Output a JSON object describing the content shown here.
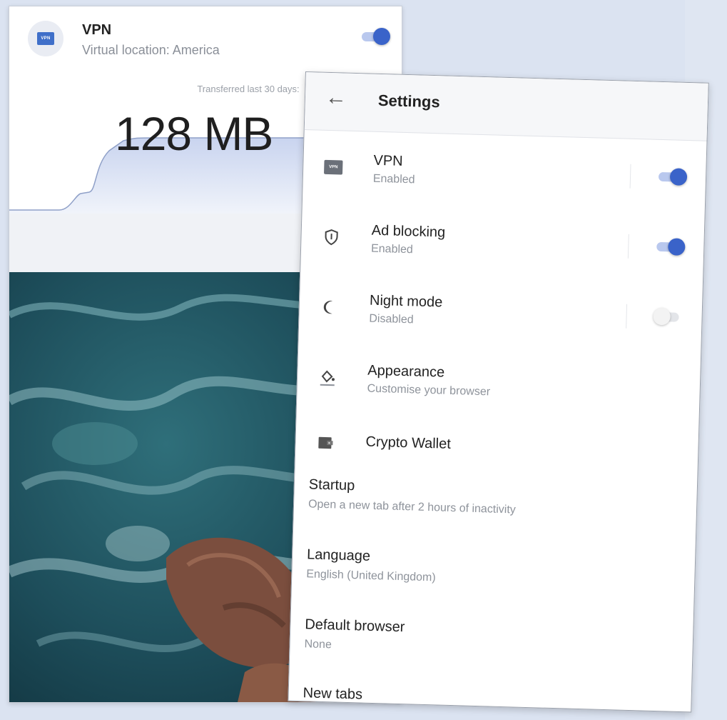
{
  "vpn_popup": {
    "badge_text": "VPN",
    "title": "VPN",
    "subtitle": "Virtual location: America",
    "transfer_label": "Transferred last 30 days:",
    "transfer_value": "128 MB",
    "toggle_on": true
  },
  "settings": {
    "title": "Settings",
    "toggle_rows": [
      {
        "label": "VPN",
        "status": "Enabled",
        "icon": "vpn-icon",
        "on": true
      },
      {
        "label": "Ad blocking",
        "status": "Enabled",
        "icon": "shield-icon",
        "on": true
      },
      {
        "label": "Night mode",
        "status": "Disabled",
        "icon": "moon-icon",
        "on": false
      }
    ],
    "icon_rows": [
      {
        "label": "Appearance",
        "sub": "Customise your browser",
        "icon": "paint-bucket-icon"
      },
      {
        "label": "Crypto Wallet",
        "sub": "",
        "icon": "wallet-icon"
      }
    ],
    "plain_rows": [
      {
        "label": "Startup",
        "sub": "Open a new tab after 2 hours of inactivity"
      },
      {
        "label": "Language",
        "sub": "English (United Kingdom)"
      },
      {
        "label": "Default browser",
        "sub": "None"
      },
      {
        "label": "New tabs",
        "sub": ""
      }
    ]
  },
  "colors": {
    "accent": "#3a63c9",
    "background": "#dbe3f1"
  }
}
